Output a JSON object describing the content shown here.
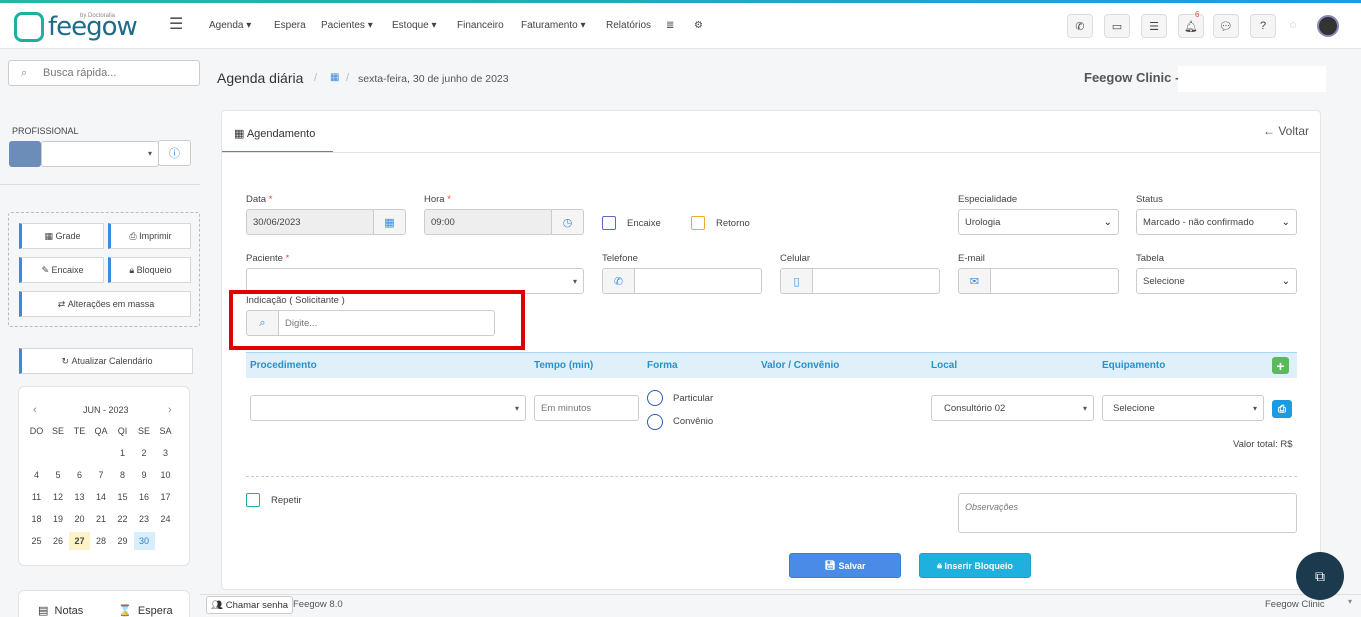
{
  "brand": {
    "name": "feegow",
    "by": "by Doctoralia"
  },
  "nav": {
    "items": [
      "Agenda",
      "Espera",
      "Pacientes",
      "Estoque",
      "Financeiro",
      "Faturamento",
      "Relatórios"
    ]
  },
  "topbar": {
    "notifications_count": "6"
  },
  "sidebar": {
    "search_placeholder": "Busca rápida...",
    "professional_label": "PROFISSIONAL",
    "buttons": {
      "grade": "Grade",
      "imprimir": "Imprimir",
      "encaixe": "Encaixe",
      "bloqueio": "Bloqueio",
      "alteracoes": "Alterações em massa",
      "atualizar": "Atualizar Calendário"
    },
    "calendar": {
      "month": "JUN - 2023",
      "weekdays": [
        "DO",
        "SE",
        "TE",
        "QA",
        "QI",
        "SE",
        "SA"
      ],
      "weeks": [
        [
          "",
          "",
          "",
          "",
          "1",
          "2",
          "3"
        ],
        [
          "4",
          "5",
          "6",
          "7",
          "8",
          "9",
          "10"
        ],
        [
          "11",
          "12",
          "13",
          "14",
          "15",
          "16",
          "17"
        ],
        [
          "18",
          "19",
          "20",
          "21",
          "22",
          "23",
          "24"
        ],
        [
          "25",
          "26",
          "27",
          "28",
          "29",
          "30",
          ""
        ]
      ],
      "today": "27",
      "selected": "30"
    },
    "bottom_tabs": {
      "notas": "Notas",
      "espera": "Espera"
    }
  },
  "header": {
    "title": "Agenda diária",
    "date": "sexta-feira, 30 de junho de 2023",
    "clinic": "Feegow Clinic -"
  },
  "form": {
    "tab": "Agendamento",
    "back": "Voltar",
    "data_label": "Data",
    "data_value": "30/06/2023",
    "hora_label": "Hora",
    "hora_value": "09:00",
    "encaixe_label": "Encaixe",
    "retorno_label": "Retorno",
    "especialidade_label": "Especialidade",
    "especialidade_value": "Urologia",
    "status_label": "Status",
    "status_value": "Marcado - não confirmado",
    "paciente_label": "Paciente",
    "telefone_label": "Telefone",
    "celular_label": "Celular",
    "email_label": "E-mail",
    "tabela_label": "Tabela",
    "tabela_value": "Selecione",
    "indicacao_label": "Indicação ( Solicitante )",
    "indicacao_placeholder": "Digite...",
    "proc_headers": {
      "procedimento": "Procedimento",
      "tempo": "Tempo (min)",
      "forma": "Forma",
      "valor": "Valor / Convênio",
      "local": "Local",
      "equipamento": "Equipamento"
    },
    "tempo_placeholder": "Em minutos",
    "forma_particular": "Particular",
    "forma_convenio": "Convênio",
    "local_value": "Consultório 02",
    "equipamento_value": "Selecione",
    "valor_total": "Valor total: R$",
    "repetir_label": "Repetir",
    "observacoes_placeholder": "Observações",
    "salvar": "Salvar",
    "inserir_bloqueio": "Inserir Bloqueio"
  },
  "footer": {
    "chamar_senha": "Chamar senha",
    "version": "Feegow 8.0",
    "clinic": "Feegow Clinic"
  }
}
